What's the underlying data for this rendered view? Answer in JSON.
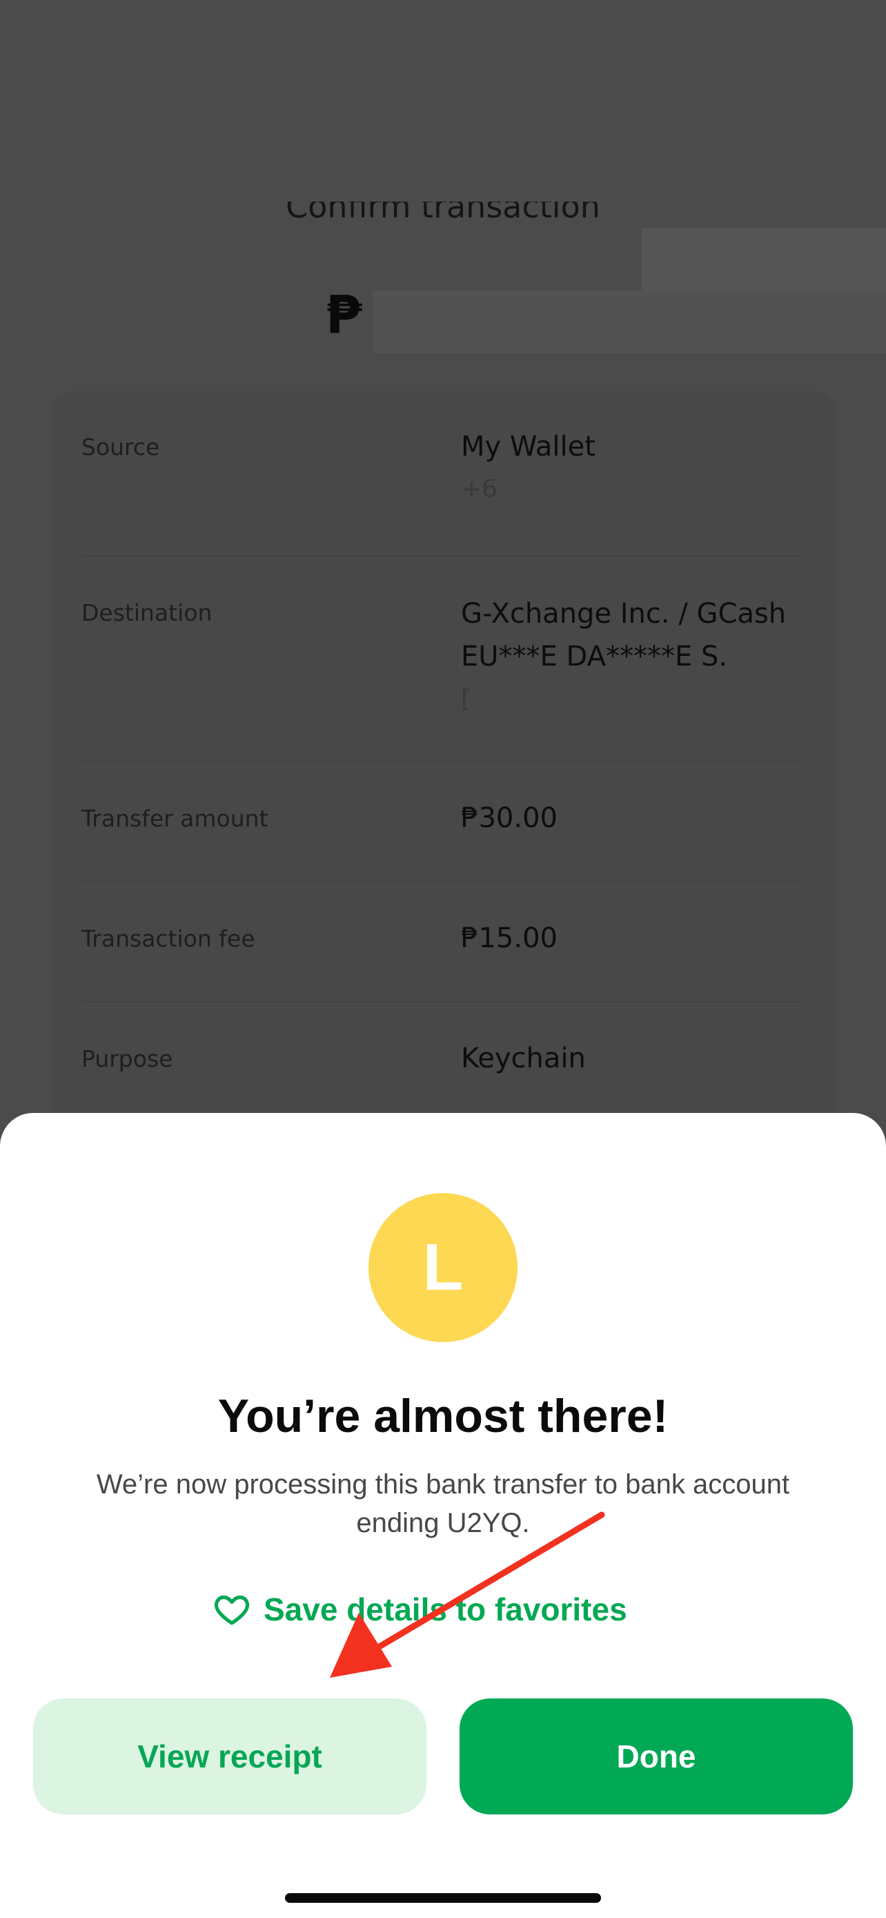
{
  "background": {
    "title": "Confirm transaction",
    "currency_symbol": "₱",
    "rows": [
      {
        "label": "Source",
        "value": "My Wallet",
        "sub": "+6"
      },
      {
        "label": "Destination",
        "value": "G-Xchange Inc. / GCash",
        "value2": "EU***E DA*****E S.",
        "sub": "["
      },
      {
        "label": "Transfer amount",
        "value": "₱30.00"
      },
      {
        "label": "Transaction fee",
        "value": "₱15.00"
      },
      {
        "label": "Purpose",
        "value": "Keychain"
      }
    ]
  },
  "sheet": {
    "avatar_letter": "L",
    "avatar_color": "#fdd853",
    "headline": "You’re almost there!",
    "message": "We’re now processing this bank transfer to bank account ending U2YQ.",
    "favorites_link": "Save details to favorites",
    "favorites_icon": "heart-outline-icon",
    "view_receipt_label": "View receipt",
    "done_label": "Done"
  },
  "colors": {
    "accent_green": "#01a955",
    "light_green": "#dcf4e2",
    "annotation_red": "#f2311f"
  }
}
